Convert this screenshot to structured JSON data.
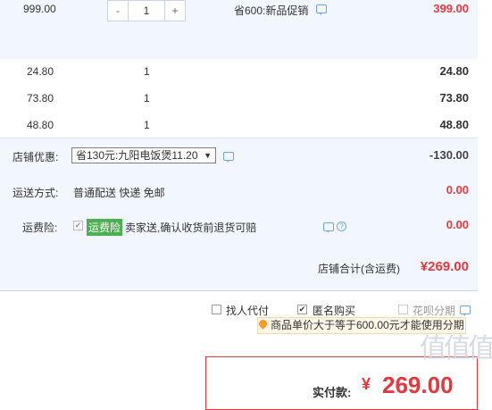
{
  "row0": {
    "unit_price": "999.00",
    "qty": "1",
    "minus": "-",
    "plus": "+",
    "promo": "省600:新品促销",
    "subtotal": "399.00"
  },
  "items": [
    {
      "price": "24.80",
      "qty": "1",
      "subtotal": "24.80"
    },
    {
      "price": "73.80",
      "qty": "1",
      "subtotal": "73.80"
    },
    {
      "price": "48.80",
      "qty": "1",
      "subtotal": "48.80"
    }
  ],
  "store": {
    "discount_label": "店铺优惠:",
    "discount_select": "省130元:九阳电饭煲11.20",
    "discount_amount": "-130.00",
    "shipping_label": "运送方式:",
    "shipping_value": "普通配送 快递 免邮",
    "shipping_amount": "0.00",
    "insurance_label": "运费险:",
    "insurance_tag": "运费险",
    "insurance_text": "卖家送,确认收货前退货可赔",
    "insurance_amount": "0.00",
    "total_label": "店铺合计(含运费)",
    "total_amount": "¥269.00"
  },
  "options": {
    "proxy_pay": "找人代付",
    "anonymous": "匿名购买",
    "huabei": "花呗分期",
    "huabei_hint": "商品单价大于等于600.00元才能使用分期"
  },
  "pay": {
    "label": "实付款:",
    "currency": "¥",
    "amount": "269.00"
  },
  "watermark": "值值值",
  "colors": {
    "accent_red": "#e4393c",
    "band_bg": "#f2f7ff",
    "tag_green": "#4caf50"
  }
}
